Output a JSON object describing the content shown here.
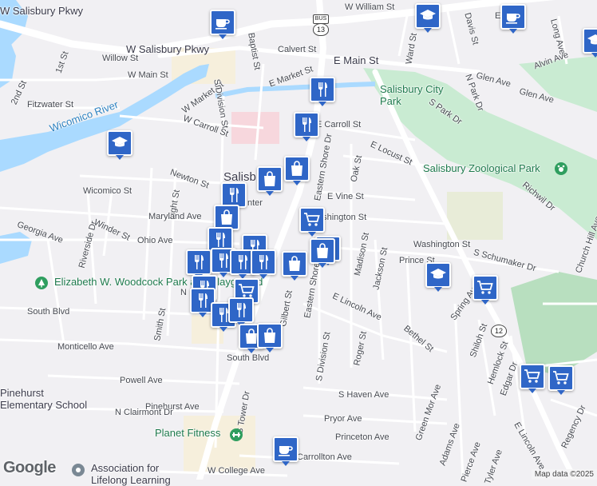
{
  "streets": {
    "w_salisbury_pkwy_1": "W Salisbury Pkwy",
    "w_salisbury_pkwy_2": "W Salisbury Pkwy",
    "w_william_st": "W William St",
    "calvert_st": "Calvert St",
    "baptist_st": "Baptist St",
    "willow_st": "Willow St",
    "first_st": "1st St",
    "w_main_st": "W Main St",
    "second_st": "2nd St",
    "e_main_st": "E Main St",
    "e_market_st": "E Market St",
    "fitzwater_st": "Fitzwater St",
    "w_market_st": "W Market St",
    "s_division_st_n": "S Division St",
    "w_carroll_st": "W Carroll St",
    "e_carroll_st": "E Carroll St",
    "wicomico_river": "Wicomico River",
    "newton_st": "Newton St",
    "wicomico_st": "Wicomico St",
    "light_st": "Light St",
    "maryland_ave": "Maryland Ave",
    "georgia_ave": "Georgia Ave",
    "riverside_dr": "Riverside Dr",
    "winder_st": "Winder St",
    "ohio_ave": "Ohio Ave",
    "eastern_shore_dr": "Eastern Shore Dr",
    "oak_st": "Oak St",
    "e_locust_st": "E Locust St",
    "e_vine_st": "E Vine St",
    "washington_st_e": "Washington St",
    "madison_st": "Madison St",
    "jackson_st": "Jackson St",
    "washington_st": "Washington St",
    "prince_st": "Prince St",
    "s_schumaker_dr": "S Schumaker Dr",
    "richwil_dr": "Richwil Dr",
    "church_hill_ave": "Church Hill Ave",
    "smith_st": "Smith St",
    "south_blvd": "South Blvd",
    "south_blvd_2": "South Blvd",
    "monticello_ave": "Monticello Ave",
    "e_lincoln_ave": "E Lincoln Ave",
    "roger_st": "Roger St",
    "s_division_st": "S Division St",
    "gilbert_st": "Gilbert St",
    "eastern_shore_dr_2": "Eastern Shore Dr",
    "bethel_st": "Bethel St",
    "shiloh_st": "Shiloh St",
    "hemlock_st": "Hemlock St",
    "spring_ave": "Spring Ave",
    "edgar_dr": "Edgar Dr",
    "powell_ave": "Powell Ave",
    "s_haven_ave": "S Haven Ave",
    "pinehurst_ave": "Pinehurst Ave",
    "n_clairmont_dr": "N Clairmont Dr",
    "s_tower_dr": "S Tower Dr",
    "pryor_ave": "Pryor Ave",
    "green_mor_ave": "Green Mor Ave",
    "adams_ave": "Adams Ave",
    "pierce_ave": "Pierce Ave",
    "tyler_ave": "Tyler Ave",
    "e_lincoln_ave_2": "E Lincoln Ave",
    "regency_dr": "Regency Dr",
    "princeton_ave": "Princeton Ave",
    "carrollton_ave": "Carrollton Ave",
    "w_college_ave": "W College Ave",
    "ward_st": "Ward St",
    "davis_st": "Davis St",
    "long_ave": "Long Ave",
    "alvin_ave": "Alvin Ave",
    "glen_ave_1": "Glen Ave",
    "glen_ave_2": "Glen Ave",
    "n_park_dr": "N Park Dr",
    "s_park_dr": "S Park Dr",
    "e_short_st": "E S",
    "salisbury_center": "Salisb",
    "hunter": "nter",
    "n_frag": "N"
  },
  "places": {
    "salisbury_city_park": "Salisbury City Park",
    "salisbury_zoo": "Salisbury Zoological Park",
    "woodcock_park": "Elizabeth W. Woodcock Park and Playground",
    "pinehurst_school": "Pinehurst Elementary School",
    "planet_fitness": "Planet Fitness",
    "assoc_lifelong": "Association for Lifelong Learning"
  },
  "shields": {
    "bus13": "BUS",
    "route13": "13",
    "route12": "12"
  },
  "attribution": {
    "google": "Google",
    "map_data": "Map data ©2025"
  },
  "colors": {
    "pin": "#2f66c7",
    "water": "#aadaff",
    "park": "#c9ebd2",
    "road": "#ffffff",
    "land": "#f1f0f3"
  }
}
